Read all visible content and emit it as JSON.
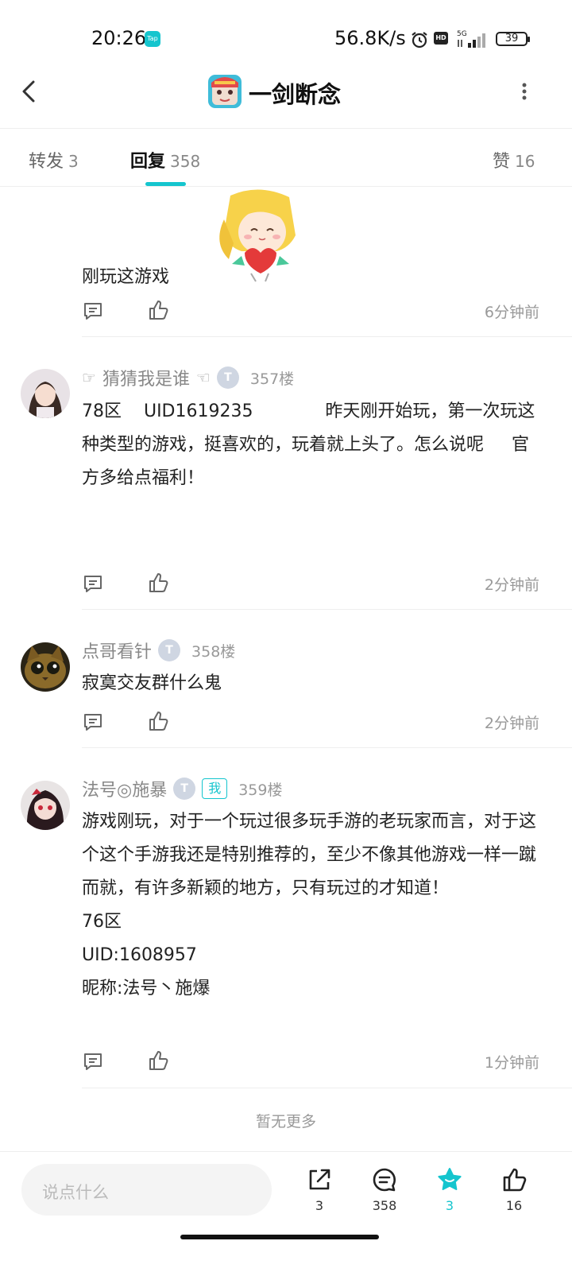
{
  "status_bar": {
    "time": "20:26",
    "tap_badge": "Tap",
    "net_speed": "56.8K/s",
    "hd": "HD",
    "signal": "5G",
    "battery": "39"
  },
  "nav": {
    "title": "一剑断念"
  },
  "tabs": [
    {
      "label": "转发",
      "count": "3"
    },
    {
      "label": "回复",
      "count": "358"
    },
    {
      "label": "赞",
      "count": "16"
    }
  ],
  "partial_comment": {
    "text": "刚玩这游戏",
    "time": "6分钟前"
  },
  "comments": [
    {
      "prefix": "☞",
      "name": "猜猜我是谁",
      "suffix": "☜",
      "badge": "T",
      "floor": "357楼",
      "text": "78区    UID1619235             昨天刚开始玩，第一次玩这种类型的游戏，挺喜欢的，玩着就上头了。怎么说呢     官方多给点福利！",
      "time": "2分钟前"
    },
    {
      "name": "点哥看针",
      "badge": "T",
      "floor": "358楼",
      "text": "寂寞交友群什么鬼",
      "time": "2分钟前"
    },
    {
      "name": "法号◎施暴",
      "badge": "T",
      "me": "我",
      "floor": "359楼",
      "text": "游戏刚玩，对于一个玩过很多玩手游的老玩家而言，对于这个这个手游我还是特别推荐的，至少不像其他游戏一样一蹴而就，有许多新颖的地方，只有玩过的才知道！\n76区\nUID:1608957\n昵称:法号丶施爆",
      "time": "1分钟前"
    }
  ],
  "no_more": "暂无更多",
  "bottom_bar": {
    "input_placeholder": "说点什么",
    "share_count": "3",
    "comment_count": "358",
    "favorite_count": "3",
    "like_count": "16"
  },
  "colors": {
    "accent": "#15c5ce",
    "muted": "#999999"
  }
}
